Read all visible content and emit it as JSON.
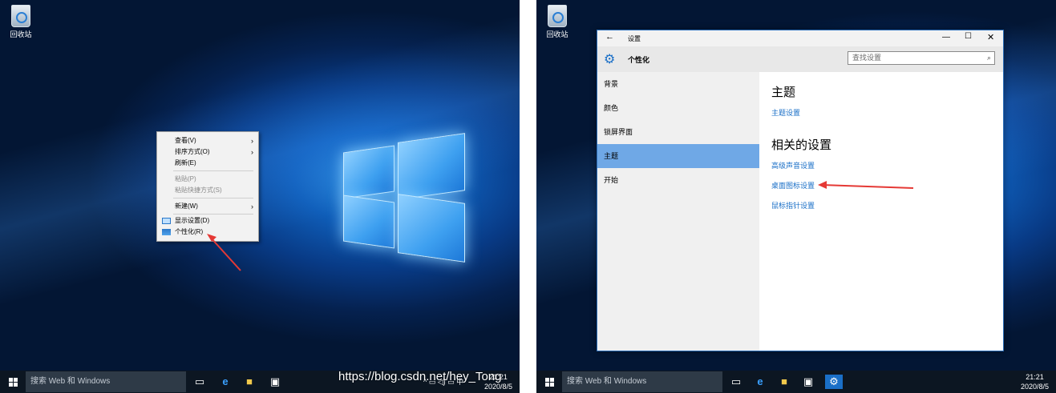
{
  "desktop": {
    "recycle_bin_label": "回收站"
  },
  "taskbar": {
    "search_placeholder": "搜索 Web 和 Windows",
    "tray_ime": "中",
    "time": "21:21",
    "date": "2020/8/5"
  },
  "context_menu": {
    "items": [
      {
        "label": "查看(V)"
      },
      {
        "label": "排序方式(O)"
      },
      {
        "label": "刷新(E)"
      },
      {
        "label": "粘贴(P)"
      },
      {
        "label": "粘贴快捷方式(S)"
      },
      {
        "label": "新建(W)"
      },
      {
        "label": "显示设置(D)"
      },
      {
        "label": "个性化(R)"
      }
    ]
  },
  "settings_window": {
    "title": "设置",
    "header": "个性化",
    "search_placeholder": "查找设置",
    "sidebar": [
      {
        "label": "背景"
      },
      {
        "label": "颜色"
      },
      {
        "label": "锁屏界面"
      },
      {
        "label": "主题"
      },
      {
        "label": "开始"
      }
    ],
    "section_theme": "主题",
    "link_theme_settings": "主题设置",
    "section_related": "相关的设置",
    "links": [
      {
        "label": "高级声音设置"
      },
      {
        "label": "桌面图标设置"
      },
      {
        "label": "鼠标指针设置"
      }
    ]
  },
  "watermark": "https://blog.csdn.net/hey_Tong",
  "colors": {
    "accent": "#1a6fc7",
    "selected": "#6fa8e6",
    "annotation_arrow": "#e53935"
  }
}
